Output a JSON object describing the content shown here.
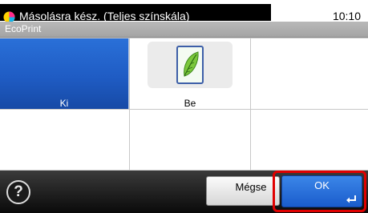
{
  "status": {
    "message": "Másolásra kész. (Teljes színskála)",
    "time": "10:10"
  },
  "title": "EcoPrint",
  "options": [
    {
      "label": "Ki",
      "selected": true
    },
    {
      "label": "Be",
      "selected": false,
      "icon": "leaf-icon"
    }
  ],
  "footer": {
    "help_label": "?",
    "cancel_label": "Mégse",
    "ok_label": "OK"
  },
  "colors": {
    "selected_blue": "#1f5cc4",
    "highlight_red": "#e00000"
  }
}
